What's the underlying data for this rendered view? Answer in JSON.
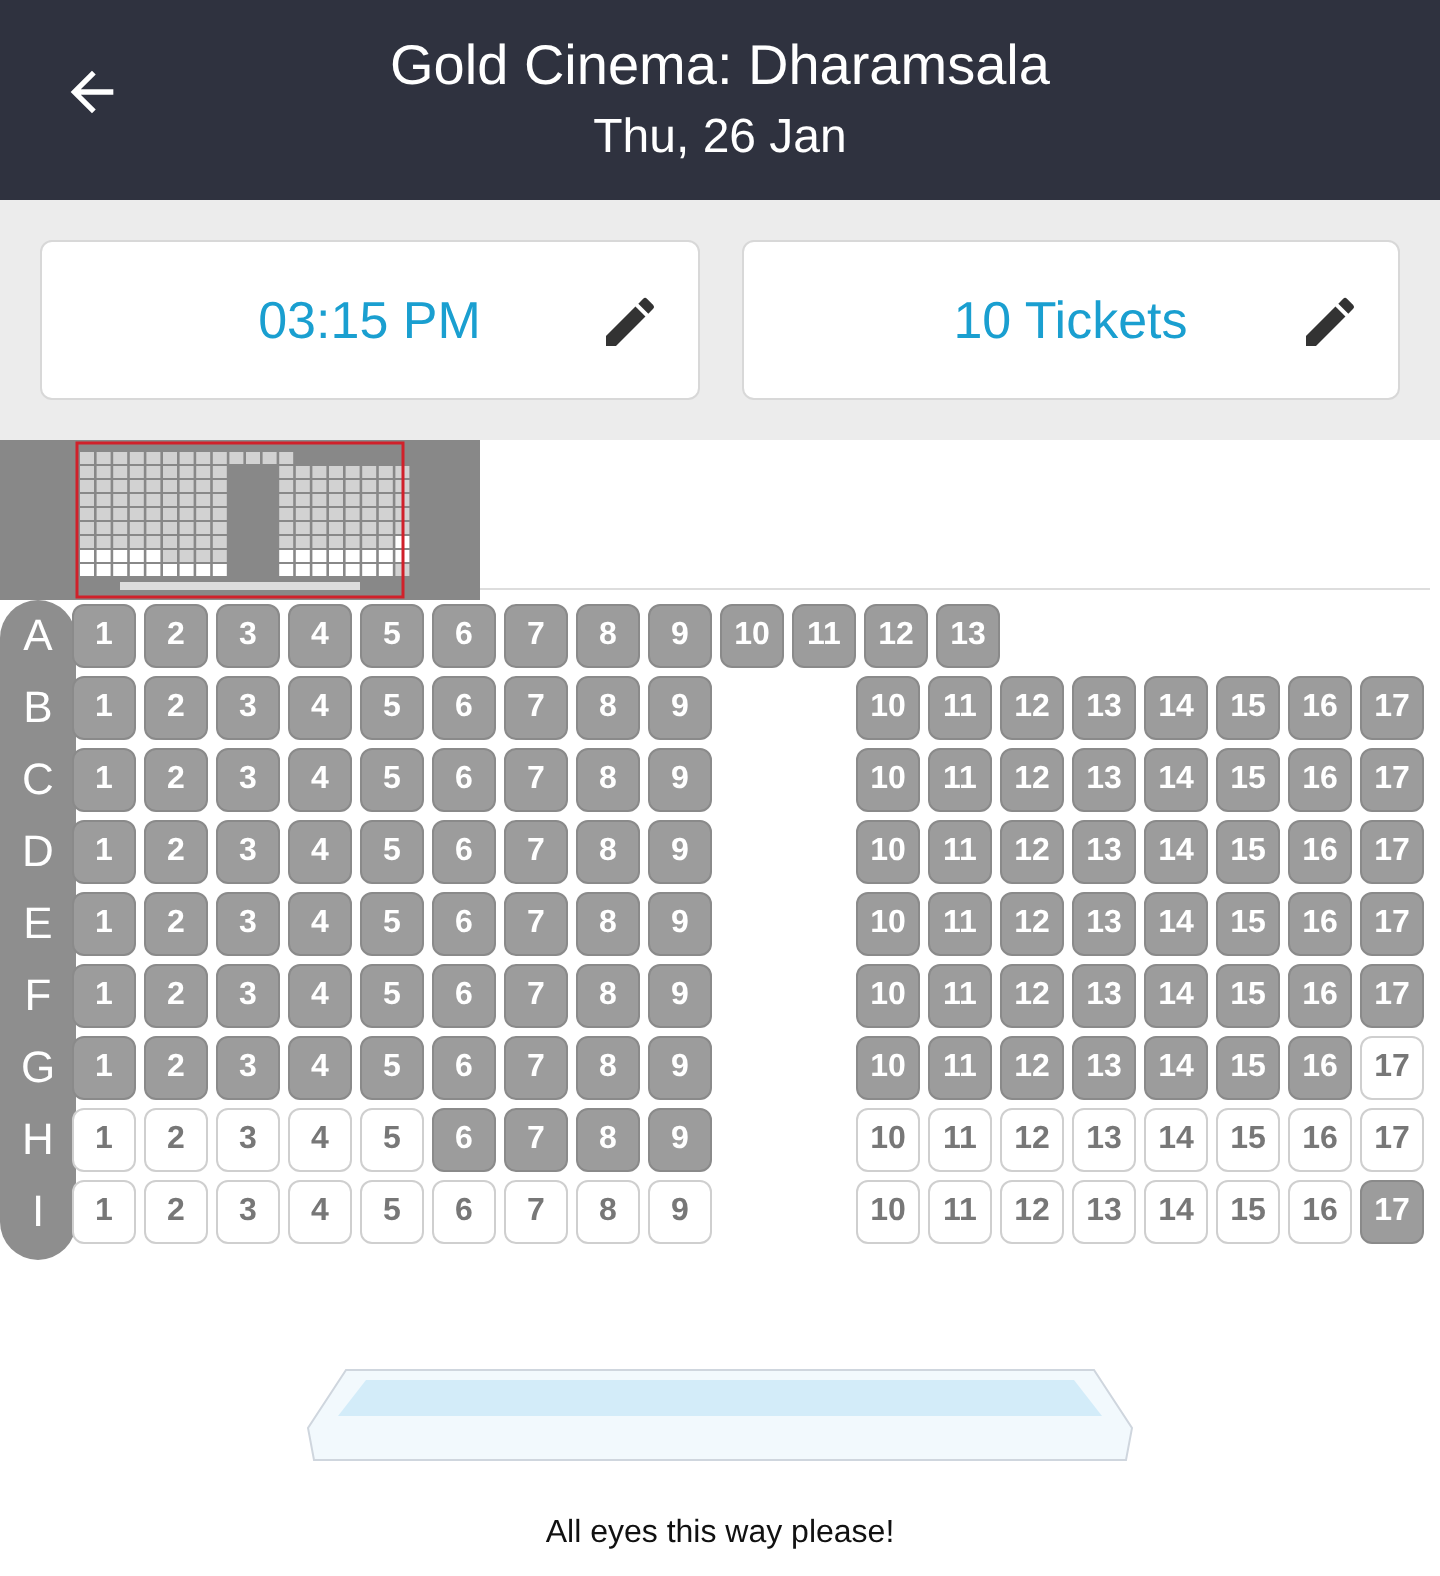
{
  "header": {
    "title": "Gold Cinema: Dharamsala",
    "date": "Thu, 26 Jan"
  },
  "selectors": [
    {
      "value": "03:15 PM"
    },
    {
      "value": "10 Tickets"
    }
  ],
  "rows": [
    {
      "label": "A",
      "blocks": [
        [
          {
            "n": "1",
            "booked": true
          },
          {
            "n": "2",
            "booked": true
          },
          {
            "n": "3",
            "booked": true
          },
          {
            "n": "4",
            "booked": true
          },
          {
            "n": "5",
            "booked": true
          },
          {
            "n": "6",
            "booked": true
          },
          {
            "n": "7",
            "booked": true
          },
          {
            "n": "8",
            "booked": true
          },
          {
            "n": "9",
            "booked": true
          },
          {
            "n": "10",
            "booked": true
          },
          {
            "n": "11",
            "booked": true
          },
          {
            "n": "12",
            "booked": true
          },
          {
            "n": "13",
            "booked": true
          }
        ]
      ]
    },
    {
      "label": "B",
      "blocks": [
        [
          {
            "n": "1",
            "booked": true
          },
          {
            "n": "2",
            "booked": true
          },
          {
            "n": "3",
            "booked": true
          },
          {
            "n": "4",
            "booked": true
          },
          {
            "n": "5",
            "booked": true
          },
          {
            "n": "6",
            "booked": true
          },
          {
            "n": "7",
            "booked": true
          },
          {
            "n": "8",
            "booked": true
          },
          {
            "n": "9",
            "booked": true
          }
        ],
        [
          {
            "n": "10",
            "booked": true
          },
          {
            "n": "11",
            "booked": true
          },
          {
            "n": "12",
            "booked": true
          },
          {
            "n": "13",
            "booked": true
          },
          {
            "n": "14",
            "booked": true
          },
          {
            "n": "15",
            "booked": true
          },
          {
            "n": "16",
            "booked": true
          },
          {
            "n": "17",
            "booked": true
          }
        ]
      ]
    },
    {
      "label": "C",
      "blocks": [
        [
          {
            "n": "1",
            "booked": true
          },
          {
            "n": "2",
            "booked": true
          },
          {
            "n": "3",
            "booked": true
          },
          {
            "n": "4",
            "booked": true
          },
          {
            "n": "5",
            "booked": true
          },
          {
            "n": "6",
            "booked": true
          },
          {
            "n": "7",
            "booked": true
          },
          {
            "n": "8",
            "booked": true
          },
          {
            "n": "9",
            "booked": true
          }
        ],
        [
          {
            "n": "10",
            "booked": true
          },
          {
            "n": "11",
            "booked": true
          },
          {
            "n": "12",
            "booked": true
          },
          {
            "n": "13",
            "booked": true
          },
          {
            "n": "14",
            "booked": true
          },
          {
            "n": "15",
            "booked": true
          },
          {
            "n": "16",
            "booked": true
          },
          {
            "n": "17",
            "booked": true
          }
        ]
      ]
    },
    {
      "label": "D",
      "blocks": [
        [
          {
            "n": "1",
            "booked": true
          },
          {
            "n": "2",
            "booked": true
          },
          {
            "n": "3",
            "booked": true
          },
          {
            "n": "4",
            "booked": true
          },
          {
            "n": "5",
            "booked": true
          },
          {
            "n": "6",
            "booked": true
          },
          {
            "n": "7",
            "booked": true
          },
          {
            "n": "8",
            "booked": true
          },
          {
            "n": "9",
            "booked": true
          }
        ],
        [
          {
            "n": "10",
            "booked": true
          },
          {
            "n": "11",
            "booked": true
          },
          {
            "n": "12",
            "booked": true
          },
          {
            "n": "13",
            "booked": true
          },
          {
            "n": "14",
            "booked": true
          },
          {
            "n": "15",
            "booked": true
          },
          {
            "n": "16",
            "booked": true
          },
          {
            "n": "17",
            "booked": true
          }
        ]
      ]
    },
    {
      "label": "E",
      "blocks": [
        [
          {
            "n": "1",
            "booked": true
          },
          {
            "n": "2",
            "booked": true
          },
          {
            "n": "3",
            "booked": true
          },
          {
            "n": "4",
            "booked": true
          },
          {
            "n": "5",
            "booked": true
          },
          {
            "n": "6",
            "booked": true
          },
          {
            "n": "7",
            "booked": true
          },
          {
            "n": "8",
            "booked": true
          },
          {
            "n": "9",
            "booked": true
          }
        ],
        [
          {
            "n": "10",
            "booked": true
          },
          {
            "n": "11",
            "booked": true
          },
          {
            "n": "12",
            "booked": true
          },
          {
            "n": "13",
            "booked": true
          },
          {
            "n": "14",
            "booked": true
          },
          {
            "n": "15",
            "booked": true
          },
          {
            "n": "16",
            "booked": true
          },
          {
            "n": "17",
            "booked": true
          }
        ]
      ]
    },
    {
      "label": "F",
      "blocks": [
        [
          {
            "n": "1",
            "booked": true
          },
          {
            "n": "2",
            "booked": true
          },
          {
            "n": "3",
            "booked": true
          },
          {
            "n": "4",
            "booked": true
          },
          {
            "n": "5",
            "booked": true
          },
          {
            "n": "6",
            "booked": true
          },
          {
            "n": "7",
            "booked": true
          },
          {
            "n": "8",
            "booked": true
          },
          {
            "n": "9",
            "booked": true
          }
        ],
        [
          {
            "n": "10",
            "booked": true
          },
          {
            "n": "11",
            "booked": true
          },
          {
            "n": "12",
            "booked": true
          },
          {
            "n": "13",
            "booked": true
          },
          {
            "n": "14",
            "booked": true
          },
          {
            "n": "15",
            "booked": true
          },
          {
            "n": "16",
            "booked": true
          },
          {
            "n": "17",
            "booked": true
          }
        ]
      ]
    },
    {
      "label": "G",
      "blocks": [
        [
          {
            "n": "1",
            "booked": true
          },
          {
            "n": "2",
            "booked": true
          },
          {
            "n": "3",
            "booked": true
          },
          {
            "n": "4",
            "booked": true
          },
          {
            "n": "5",
            "booked": true
          },
          {
            "n": "6",
            "booked": true
          },
          {
            "n": "7",
            "booked": true
          },
          {
            "n": "8",
            "booked": true
          },
          {
            "n": "9",
            "booked": true
          }
        ],
        [
          {
            "n": "10",
            "booked": true
          },
          {
            "n": "11",
            "booked": true
          },
          {
            "n": "12",
            "booked": true
          },
          {
            "n": "13",
            "booked": true
          },
          {
            "n": "14",
            "booked": true
          },
          {
            "n": "15",
            "booked": true
          },
          {
            "n": "16",
            "booked": true
          },
          {
            "n": "17",
            "booked": false
          }
        ]
      ]
    },
    {
      "label": "H",
      "blocks": [
        [
          {
            "n": "1",
            "booked": false
          },
          {
            "n": "2",
            "booked": false
          },
          {
            "n": "3",
            "booked": false
          },
          {
            "n": "4",
            "booked": false
          },
          {
            "n": "5",
            "booked": false
          },
          {
            "n": "6",
            "booked": true
          },
          {
            "n": "7",
            "booked": true
          },
          {
            "n": "8",
            "booked": true
          },
          {
            "n": "9",
            "booked": true
          }
        ],
        [
          {
            "n": "10",
            "booked": false
          },
          {
            "n": "11",
            "booked": false
          },
          {
            "n": "12",
            "booked": false
          },
          {
            "n": "13",
            "booked": false
          },
          {
            "n": "14",
            "booked": false
          },
          {
            "n": "15",
            "booked": false
          },
          {
            "n": "16",
            "booked": false
          },
          {
            "n": "17",
            "booked": false
          }
        ]
      ]
    },
    {
      "label": "I",
      "blocks": [
        [
          {
            "n": "1",
            "booked": false
          },
          {
            "n": "2",
            "booked": false
          },
          {
            "n": "3",
            "booked": false
          },
          {
            "n": "4",
            "booked": false
          },
          {
            "n": "5",
            "booked": false
          },
          {
            "n": "6",
            "booked": false
          },
          {
            "n": "7",
            "booked": false
          },
          {
            "n": "8",
            "booked": false
          },
          {
            "n": "9",
            "booked": false
          }
        ],
        [
          {
            "n": "10",
            "booked": false
          },
          {
            "n": "11",
            "booked": false
          },
          {
            "n": "12",
            "booked": false
          },
          {
            "n": "13",
            "booked": false
          },
          {
            "n": "14",
            "booked": false
          },
          {
            "n": "15",
            "booked": false
          },
          {
            "n": "16",
            "booked": false
          },
          {
            "n": "17",
            "booked": true
          }
        ]
      ]
    }
  ],
  "screen_caption": "All eyes this way please!"
}
